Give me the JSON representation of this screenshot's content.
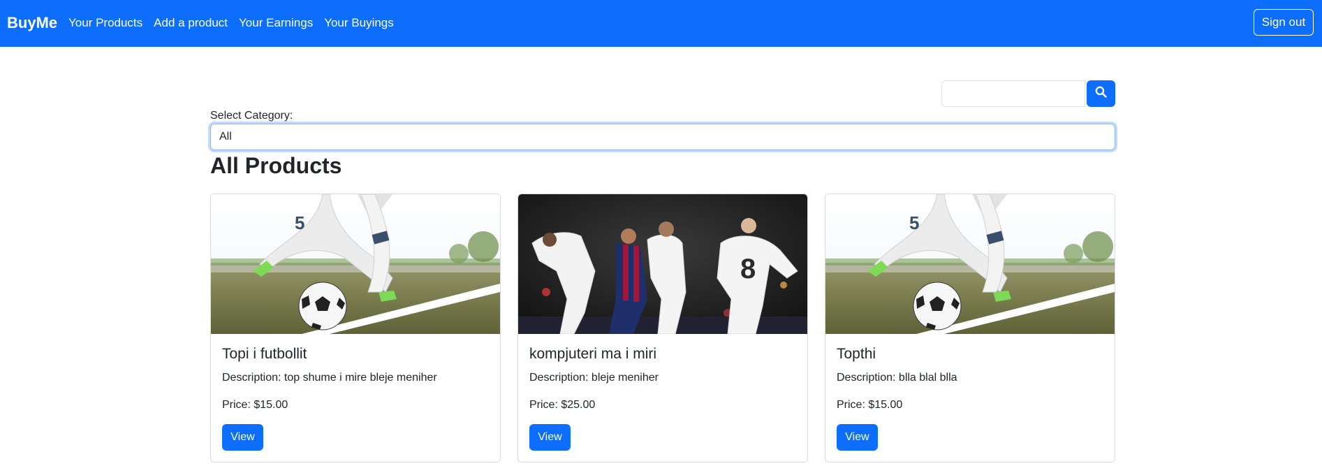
{
  "navbar": {
    "brand": "BuyMe",
    "links": [
      "Your Products",
      "Add a product",
      "Your Earnings",
      "Your Buyings"
    ],
    "signout_label": "Sign out",
    "background": "#0d6efd"
  },
  "search": {
    "value": "",
    "placeholder": "",
    "button_icon": "search-icon"
  },
  "filter": {
    "label": "Select Category:",
    "selected": "All"
  },
  "main": {
    "title": "All Products"
  },
  "products": [
    {
      "title": "Topi i futbollit",
      "description": "Description: top shume i mire bleje meniher",
      "price": "Price: $15.00",
      "button": "View",
      "image": "soccer-kick-photo"
    },
    {
      "title": "kompjuteri ma i miri",
      "description": "Description: bleje meniher",
      "price": "Price: $25.00",
      "button": "View",
      "image": "football-match-photo"
    },
    {
      "title": "Topthi",
      "description": "Description: blla blal blla",
      "price": "Price: $15.00",
      "button": "View",
      "image": "soccer-kick-photo"
    }
  ]
}
